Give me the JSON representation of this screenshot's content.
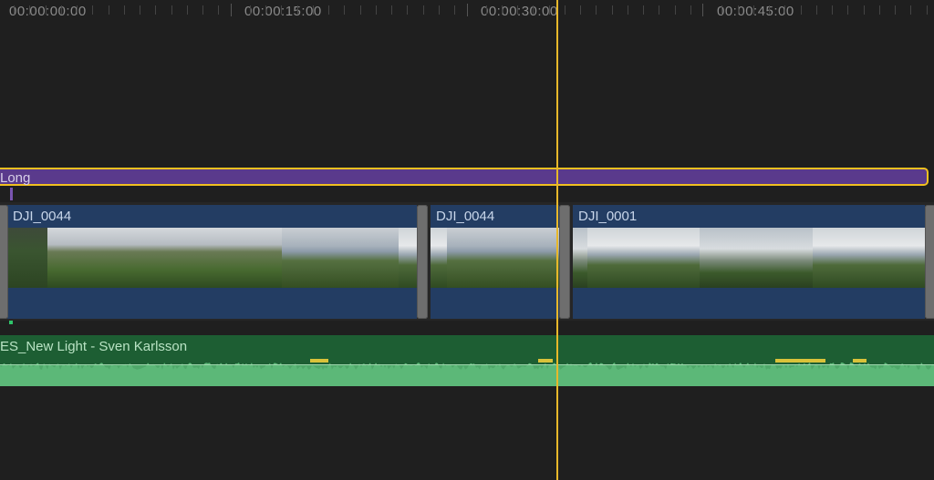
{
  "ruler": {
    "timecodes": [
      "00:00:00:00",
      "00:00:15:00",
      "00:00:30:00",
      "00:00:45:00"
    ]
  },
  "title_clip": {
    "label": "Long"
  },
  "video_clips": [
    {
      "label": "DJI_0044"
    },
    {
      "label": "DJI_0044"
    },
    {
      "label": "DJI_0001"
    }
  ],
  "audio_clip": {
    "label": "ES_New Light - Sven Karlsson"
  },
  "colors": {
    "playhead": "#e8b82a",
    "title_clip": "#5a3a8c",
    "video_clip": "#233d63",
    "audio_clip": "#1d5e33",
    "selection": "#f0c020"
  },
  "icons": {
    "playhead": "playhead-line"
  }
}
